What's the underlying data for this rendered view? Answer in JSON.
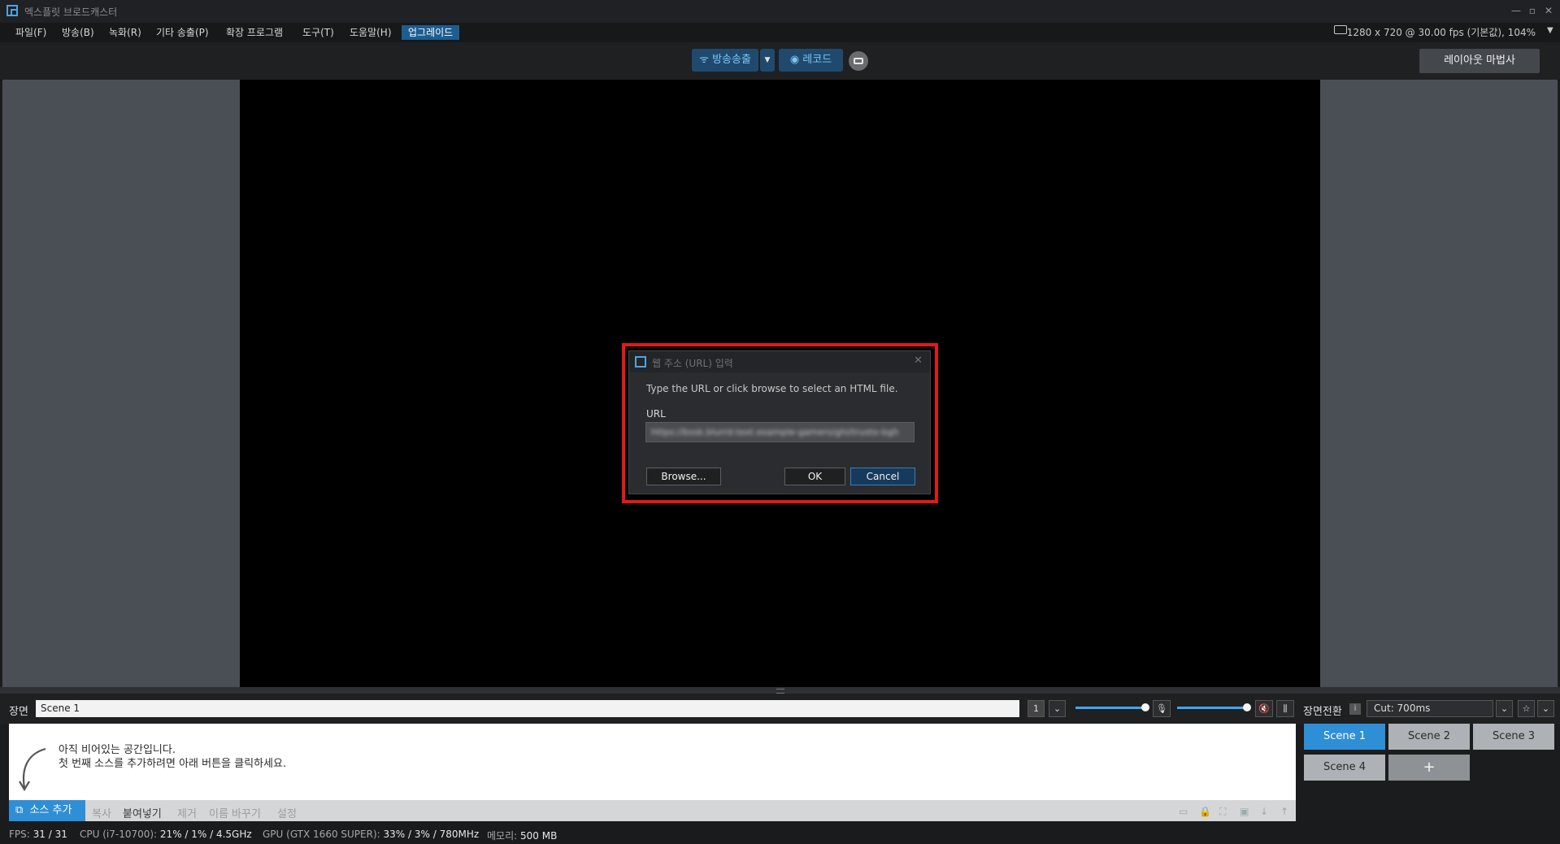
{
  "window": {
    "title": "엑스플릿 브로드캐스터",
    "controls": [
      "—",
      "▫",
      "✕"
    ]
  },
  "menu": {
    "items": [
      "파일(F)",
      "방송(B)",
      "녹화(R)",
      "기타 송출(P)",
      "확장 프로그램",
      "도구(T)",
      "도움말(H)",
      "업그레이드"
    ],
    "resolution": "1280 x 720 @ 30.00 fps (기본값), 104%"
  },
  "toolbar": {
    "broadcast_label": "방송송출",
    "record_label": "레코드",
    "layout_wizard_label": "레이아웃 마법사"
  },
  "dialog": {
    "title": "웹 주소 (URL) 입력",
    "instruction": "Type the URL or click browse to select an HTML file.",
    "url_label": "URL",
    "url_value": "https://bssk.blurrd-text.example-gamers/ghi/trusto-bgh",
    "browse_label": "Browse...",
    "ok_label": "OK",
    "cancel_label": "Cancel"
  },
  "scenes": {
    "label": "장면",
    "current_name": "Scene 1",
    "scene_number": "1",
    "empty_line1": "아직 비어있는 공간입니다.",
    "empty_line2": "첫 번째 소스를 추가하려면 아래 버튼을 클릭하세요.",
    "actions": {
      "add": "소스 추가",
      "copy": "복사",
      "paste": "붙여넣기",
      "remove": "제거",
      "rename": "이름 바꾸기",
      "settings": "설정"
    },
    "buttons": [
      "Scene 1",
      "Scene 2",
      "Scene 3",
      "Scene 4"
    ],
    "add_scene": "+"
  },
  "transition": {
    "label": "장면전환",
    "value": "Cut: 700ms"
  },
  "status": {
    "fps_label": "FPS:",
    "fps_value": "31 / 31",
    "cpu_label": "CPU (i7-10700):",
    "cpu_value": "21% / 1% / 4.5GHz",
    "gpu_label": "GPU (GTX 1660 SUPER):",
    "gpu_value": "33% / 3% / 780MHz",
    "mem_label": "메모리:",
    "mem_value": "500 MB"
  },
  "colors": {
    "accent": "#2e8fd6",
    "highlight_frame": "#e01a1a"
  }
}
